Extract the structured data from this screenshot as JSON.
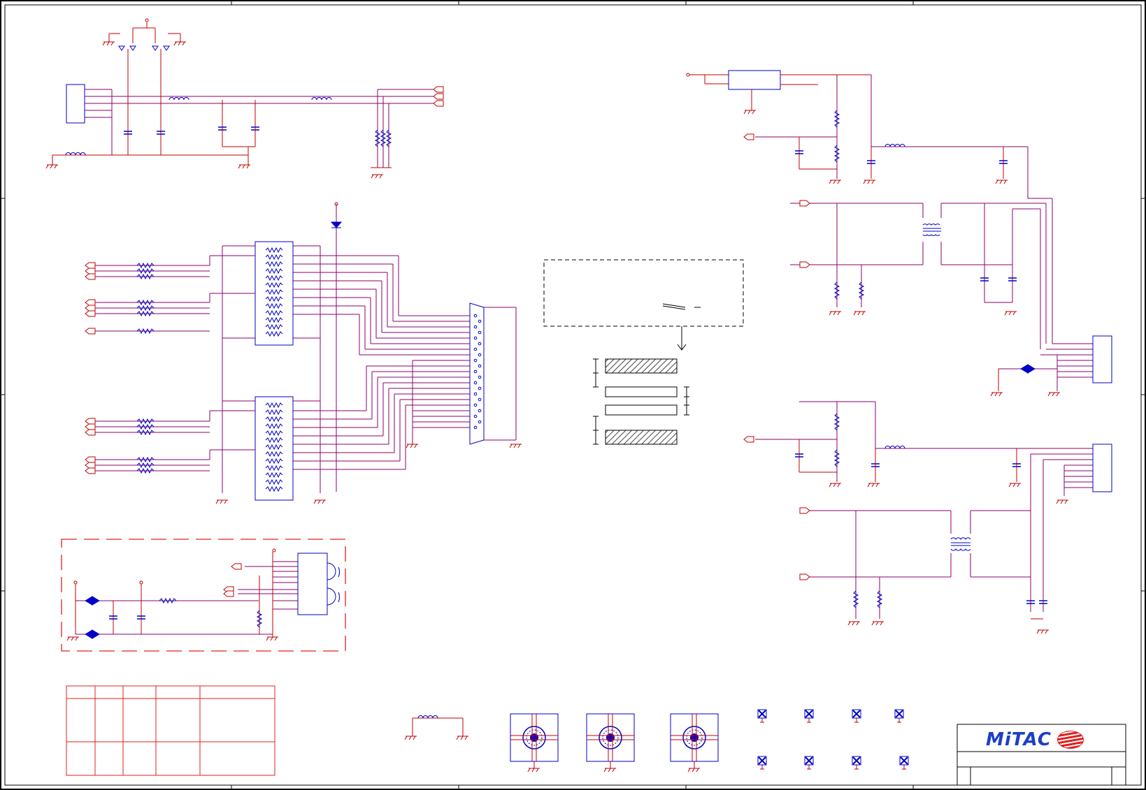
{
  "sheet": {
    "type": "electrical schematic",
    "frame_color": "#000000"
  },
  "colors": {
    "wire": "#c00000",
    "bus_magenta": "#8b006b",
    "component": "#0000c8",
    "frame": "#000000",
    "hatch": "#444444",
    "logo_blue": "#1a3fc8",
    "logo_red": "#e02020"
  },
  "title_block": {
    "logo_text": "MiTAC"
  },
  "connectors": {
    "vga_db15": {
      "icon": "db-connector-icon"
    },
    "audio_jack": {
      "icon": "audio-jack-icon"
    },
    "headers": [
      {
        "icon": "header-connector-icon"
      },
      {
        "icon": "header-connector-icon"
      },
      {
        "icon": "header-connector-icon"
      },
      {
        "icon": "header-connector-icon"
      }
    ]
  },
  "mounting": {
    "screw_hole_icon": "screw-hole-icon",
    "test_pad_icon": "test-pad-icon"
  },
  "revision_table": {
    "columns": 5,
    "rows": 2
  }
}
